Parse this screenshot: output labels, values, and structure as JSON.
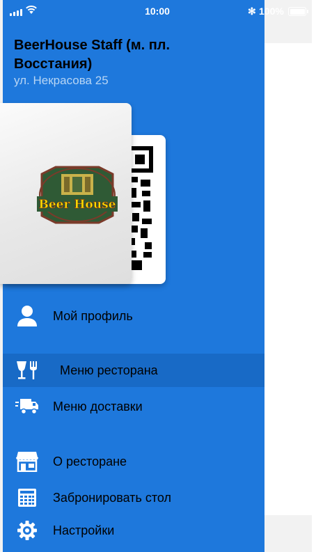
{
  "status_bar": {
    "time": "10:00",
    "battery_percent": "100%",
    "bluetooth_symbol": "✻"
  },
  "header": {
    "title": "BeerHouse Staff (м. пл. Восстания)",
    "address": "ул. Некрасова 25"
  },
  "card": {
    "logo_text": "Beer House"
  },
  "menu": {
    "items": [
      {
        "label": "Мой профиль",
        "icon": "user-icon",
        "active": false
      },
      {
        "label": "Меню ресторана",
        "icon": "restaurant-icon",
        "active": true
      },
      {
        "label": "Меню доставки",
        "icon": "delivery-truck-icon",
        "active": false
      },
      {
        "label": "О ресторане",
        "icon": "storefront-icon",
        "active": false
      },
      {
        "label": "Забронировать стол",
        "icon": "calendar-icon",
        "active": false
      },
      {
        "label": "Настройки",
        "icon": "settings-icon",
        "active": false
      }
    ]
  },
  "colors": {
    "drawer_bg": "#1e78dc",
    "active_item_bg": "#186ac6",
    "address_text": "#b7d5f4"
  }
}
